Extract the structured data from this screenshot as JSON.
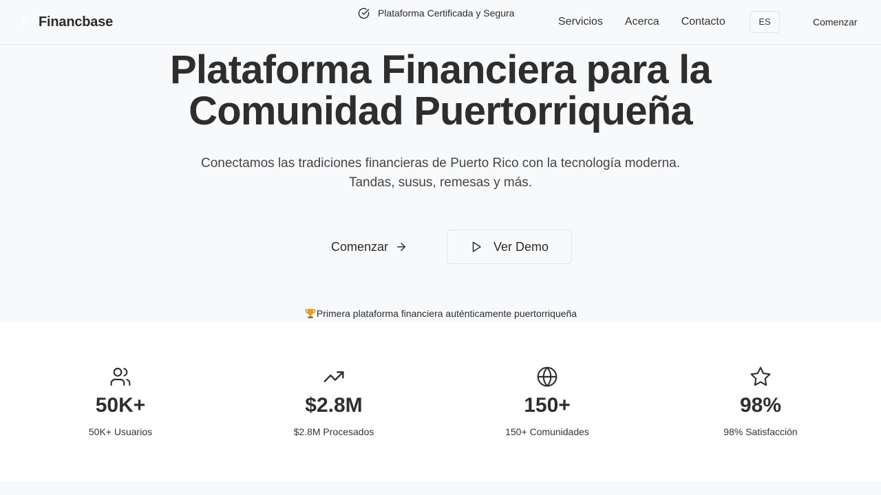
{
  "header": {
    "logo_letter": "F",
    "brand": "Financbase",
    "certification": "Plataforma Certificada y Segura",
    "nav": [
      "Servicios",
      "Acerca",
      "Contacto"
    ],
    "language": "ES",
    "cta": "Comenzar"
  },
  "hero": {
    "title_line1": "Plataforma Financiera para la",
    "title_line2": "Comunidad Puertorriqueña",
    "subtitle_line1": "Conectamos las tradiciones financieras de Puerto Rico con la tecnología moderna.",
    "subtitle_line2": "Tandas, susus, remesas y más.",
    "primary_button": "Comenzar",
    "secondary_button": "Ver Demo",
    "badge": "Primera plataforma financiera auténticamente puertorriqueña"
  },
  "stats": [
    {
      "icon": "users-icon",
      "value": "50K+",
      "label": "50K+ Usuarios"
    },
    {
      "icon": "trending-up-icon",
      "value": "$2.8M",
      "label": "$2.8M Procesados"
    },
    {
      "icon": "globe-icon",
      "value": "150+",
      "label": "150+ Comunidades"
    },
    {
      "icon": "star-icon",
      "value": "98%",
      "label": "98% Satisfacción"
    }
  ],
  "colors": {
    "text": "#2e2e2e",
    "background": "#f8f9fb",
    "stats_background": "#ffffff",
    "border": "#e2e4e8"
  }
}
